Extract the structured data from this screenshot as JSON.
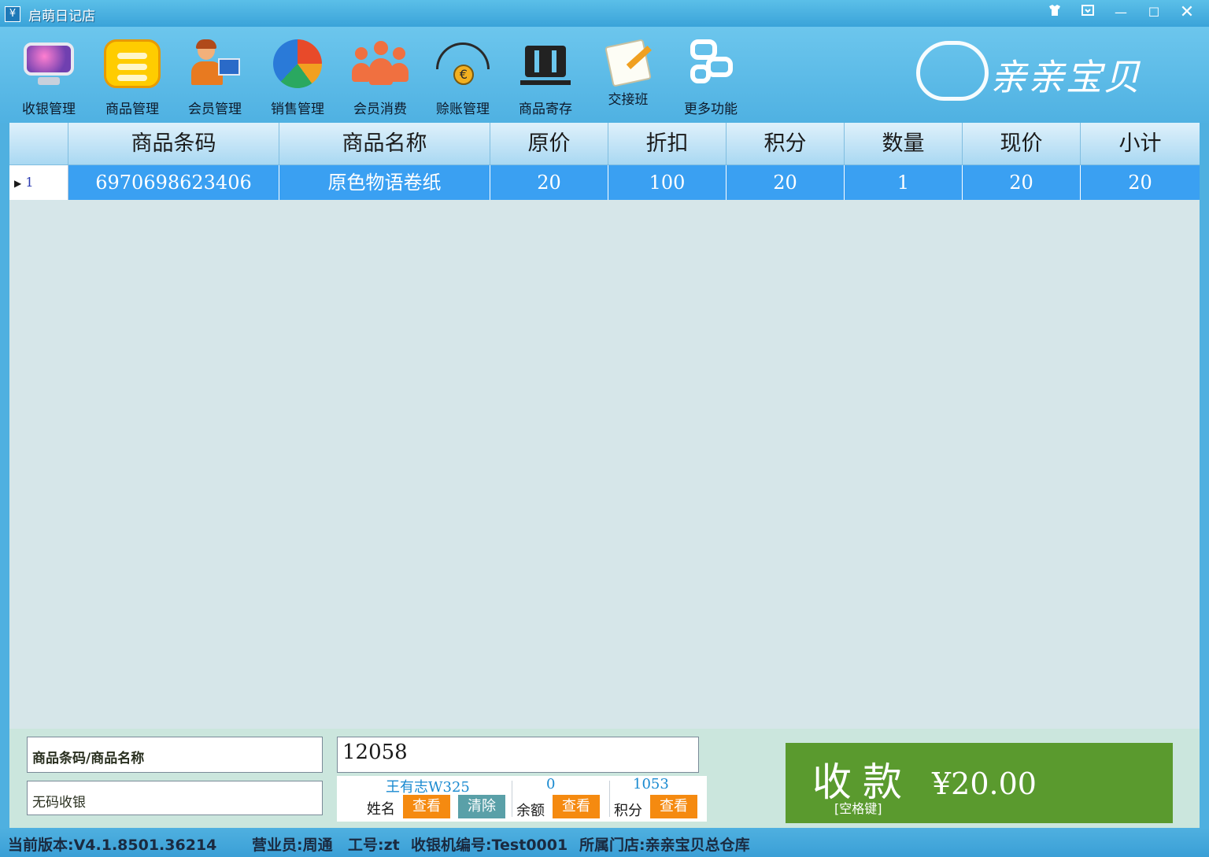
{
  "window": {
    "title": "启萌日记店",
    "app_icon_glyph": "¥",
    "controls": {
      "skin_icon": "skin-icon",
      "restore_icon": "restore-icon",
      "minimize_glyph": "—",
      "maximize_glyph": "☐",
      "close_glyph": "✕"
    }
  },
  "toolbar": {
    "items": [
      {
        "label": "收银管理",
        "icon": "monitor-icon"
      },
      {
        "label": "商品管理",
        "icon": "coins-icon"
      },
      {
        "label": "会员管理",
        "icon": "member-icon"
      },
      {
        "label": "销售管理",
        "icon": "pie-chart-icon"
      },
      {
        "label": "会员消费",
        "icon": "group-icon"
      },
      {
        "label": "赊账管理",
        "icon": "umbrella-euro-icon"
      },
      {
        "label": "商品寄存",
        "icon": "storage-icon"
      },
      {
        "label": "交接班",
        "icon": "handover-icon"
      },
      {
        "label": "更多功能",
        "icon": "more-icon"
      }
    ],
    "logo_text": "亲亲宝贝"
  },
  "grid": {
    "columns": [
      "",
      "商品条码",
      "商品名称",
      "原价",
      "折扣",
      "积分",
      "数量",
      "现价",
      "小计"
    ],
    "rows": [
      {
        "index": "1",
        "barcode": "6970698623406",
        "name": "原色物语卷纸",
        "price": "20",
        "discount": "100",
        "points": "20",
        "qty": "1",
        "current_price": "20",
        "subtotal": "20"
      }
    ]
  },
  "bottom": {
    "barcode_placeholder": "商品条码/商品名称",
    "nocode_label": "无码收银",
    "member_input_value": "12058",
    "member": {
      "name_value": "王有志W325",
      "name_label": "姓名",
      "view_label": "查看",
      "clear_label": "清除",
      "balance_value": "0",
      "balance_label": "余额",
      "points_value": "1053",
      "points_label": "积分"
    },
    "pay": {
      "label": "收款",
      "hint": "[空格键]",
      "amount": "¥20.00"
    }
  },
  "status": {
    "version": "当前版本:V4.1.8501.36214",
    "clerk": "营业员:周通",
    "employee_id": "工号:zt",
    "register_id": "收银机编号:Test0001",
    "store": "所属门店:亲亲宝贝总仓库"
  },
  "colors": {
    "selected_row": "#3aa0f2",
    "pay_button": "#5a9a2e",
    "orange_button": "#f58a10",
    "teal_button": "#5aa0a8"
  }
}
